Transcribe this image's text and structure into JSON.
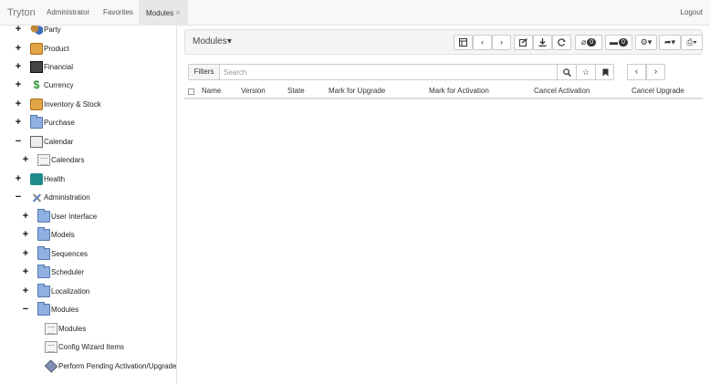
{
  "navbar": {
    "brand": "Tryton",
    "tabs": [
      {
        "label": "Administrator"
      },
      {
        "label": "Favorites"
      },
      {
        "label": "Modules",
        "close": "×"
      }
    ],
    "logout": "Logout"
  },
  "sidebar": {
    "items": [
      {
        "expander": "+",
        "icon": "party-icon",
        "label": "Party"
      },
      {
        "expander": "+",
        "icon": "box-icon",
        "label": "Product"
      },
      {
        "expander": "+",
        "icon": "financial-icon",
        "label": "Financial"
      },
      {
        "expander": "+",
        "icon": "currency-icon",
        "label": "Currency"
      },
      {
        "expander": "+",
        "icon": "box-icon",
        "label": "Inventory & Stock"
      },
      {
        "expander": "+",
        "icon": "folder-icon",
        "label": "Purchase"
      },
      {
        "expander": "−",
        "icon": "calendar-icon",
        "label": "Calendar"
      },
      {
        "expander": "+",
        "icon": "document-icon",
        "label": "Calendars"
      },
      {
        "expander": "+",
        "icon": "health-icon",
        "label": "Health"
      },
      {
        "expander": "−",
        "icon": "tools-icon",
        "label": "Administration"
      },
      {
        "expander": "+",
        "icon": "folder-icon",
        "label": "User Interface"
      },
      {
        "expander": "+",
        "icon": "folder-icon",
        "label": "Models"
      },
      {
        "expander": "+",
        "icon": "folder-icon",
        "label": "Sequences"
      },
      {
        "expander": "+",
        "icon": "folder-icon",
        "label": "Scheduler"
      },
      {
        "expander": "+",
        "icon": "folder-icon",
        "label": "Localization"
      },
      {
        "expander": "−",
        "icon": "folder-icon",
        "label": "Modules"
      },
      {
        "expander": "",
        "icon": "document-icon",
        "label": "Modules"
      },
      {
        "expander": "",
        "icon": "document-icon",
        "label": "Config Wizard Items"
      },
      {
        "expander": "",
        "icon": "wizard-icon",
        "label": "Perform Pending Activation/Upgrade"
      }
    ]
  },
  "toolbar": {
    "title": "Modules",
    "caret": "▾",
    "attachment_count": "0",
    "note_count": "0"
  },
  "filter": {
    "filters_label": "Filters",
    "search_placeholder": "Search"
  },
  "grid": {
    "columns": [
      "Name",
      "Version",
      "State",
      "Mark for Upgrade",
      "Mark for Activation",
      "Cancel Activation",
      "Cancel Upgrade"
    ]
  }
}
